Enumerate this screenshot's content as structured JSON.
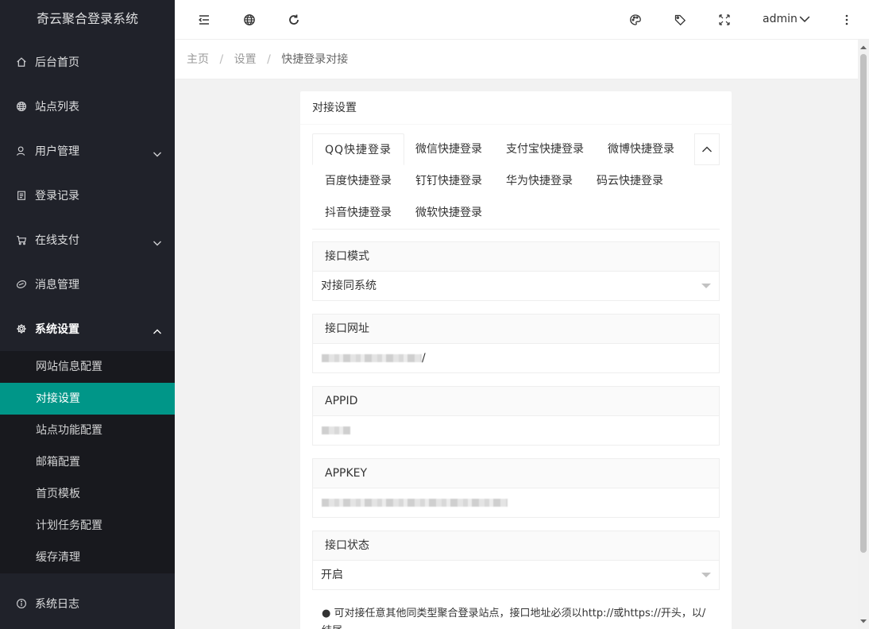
{
  "sidebar": {
    "logo": "奇云聚合登录系统",
    "items": [
      {
        "label": "后台首页",
        "icon": "home-icon"
      },
      {
        "label": "站点列表",
        "icon": "globe-icon"
      },
      {
        "label": "用户管理",
        "icon": "user-icon"
      },
      {
        "label": "登录记录",
        "icon": "clipboard-icon"
      },
      {
        "label": "在线支付",
        "icon": "cart-icon"
      },
      {
        "label": "消息管理",
        "icon": "message-icon"
      },
      {
        "label": "系统设置",
        "icon": "gear-icon"
      }
    ],
    "sub_items": [
      "网站信息配置",
      "对接设置",
      "站点功能配置",
      "邮箱配置",
      "首页模板",
      "计划任务配置",
      "缓存清理"
    ],
    "bottom_item": {
      "label": "系统日志",
      "icon": "info-icon"
    }
  },
  "header": {
    "user": "admin"
  },
  "breadcrumb": {
    "items": [
      "主页",
      "设置"
    ],
    "current": "快捷登录对接",
    "separator": "/"
  },
  "card": {
    "title": "对接设置",
    "tabs": [
      "QQ快捷登录",
      "微信快捷登录",
      "支付宝快捷登录",
      "微博快捷登录",
      "百度快捷登录",
      "钉钉快捷登录",
      "华为快捷登录",
      "码云快捷登录",
      "抖音快捷登录",
      "微软快捷登录"
    ],
    "fields": [
      {
        "label": "接口模式",
        "value": "对接同系统",
        "type": "select"
      },
      {
        "label": "接口网址",
        "value": "",
        "type": "text",
        "suffix": "/"
      },
      {
        "label": "APPID",
        "value": "",
        "type": "text"
      },
      {
        "label": "APPKEY",
        "value": "",
        "type": "text"
      },
      {
        "label": "接口状态",
        "value": "开启",
        "type": "select"
      }
    ],
    "note": "● 可对接任意其他同类型聚合登录站点，接口地址必须以http://或https://开头，以/结尾"
  },
  "colors": {
    "sidebar_bg": "#20222a",
    "active_item": "#009688"
  }
}
